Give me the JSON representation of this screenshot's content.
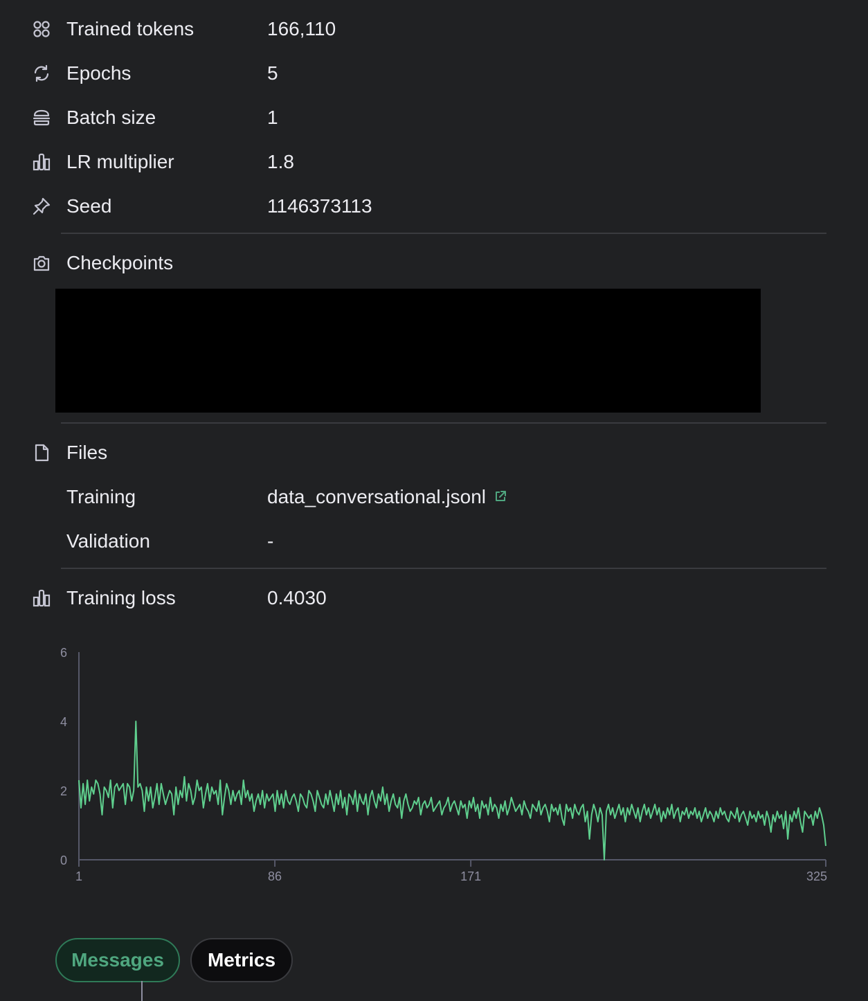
{
  "params": {
    "trained_tokens": {
      "label": "Trained tokens",
      "value": "166,110",
      "icon": "grid-dots-icon"
    },
    "epochs": {
      "label": "Epochs",
      "value": "5",
      "icon": "refresh-icon"
    },
    "batch_size": {
      "label": "Batch size",
      "value": "1",
      "icon": "stack-icon"
    },
    "lr_multiplier": {
      "label": "LR multiplier",
      "value": "1.8",
      "icon": "bar-chart-icon"
    },
    "seed": {
      "label": "Seed",
      "value": "1146373113",
      "icon": "pin-icon"
    }
  },
  "checkpoints": {
    "label": "Checkpoints",
    "icon": "camera-icon"
  },
  "files": {
    "label": "Files",
    "icon": "file-icon",
    "training_label": "Training",
    "training_value": "data_conversational.jsonl",
    "validation_label": "Validation",
    "validation_value": "-"
  },
  "training_loss": {
    "label": "Training loss",
    "value": "0.4030",
    "icon": "bar-chart-icon"
  },
  "colors": {
    "accent": "#4fa67f",
    "loss_line": "#5fcf8e",
    "background": "#202123"
  },
  "chart_data": {
    "type": "line",
    "title": "",
    "xlabel": "",
    "ylabel": "",
    "xlim": [
      1,
      325
    ],
    "ylim": [
      0,
      6
    ],
    "x_ticks": [
      "1",
      "86",
      "171",
      "325"
    ],
    "x_tick_values": [
      1,
      86,
      171,
      325
    ],
    "y_ticks": [
      "0",
      "2",
      "4",
      "6"
    ],
    "y_tick_values": [
      0,
      2,
      4,
      6
    ],
    "grid": false,
    "series": [
      {
        "name": "",
        "values": [
          2.3,
          1.5,
          2.2,
          1.6,
          2.3,
          1.7,
          2.1,
          1.9,
          2.3,
          2.2,
          1.9,
          1.3,
          2.1,
          2.0,
          1.8,
          2.3,
          1.5,
          2.1,
          2.2,
          2.0,
          2.1,
          2.2,
          1.6,
          2.2,
          2.1,
          1.7,
          2.0,
          4.0,
          2.1,
          2.2,
          2.0,
          1.4,
          2.1,
          1.7,
          2.1,
          1.5,
          1.8,
          2.2,
          1.6,
          2.2,
          1.9,
          1.6,
          1.8,
          2.0,
          1.9,
          1.3,
          2.1,
          1.6,
          2.0,
          1.8,
          2.4,
          1.7,
          2.2,
          2.0,
          1.6,
          1.8,
          2.3,
          2.0,
          2.1,
          1.5,
          1.9,
          2.2,
          1.7,
          2.1,
          1.9,
          2.0,
          1.6,
          2.3,
          1.3,
          1.8,
          2.2,
          2.0,
          1.6,
          2.0,
          1.7,
          1.9,
          2.0,
          1.6,
          2.3,
          1.8,
          2.0,
          1.7,
          1.9,
          1.4,
          1.7,
          1.9,
          1.6,
          2.0,
          1.5,
          1.9,
          1.7,
          1.8,
          1.9,
          1.4,
          2.0,
          1.6,
          1.9,
          1.5,
          2.0,
          1.7,
          1.6,
          1.8,
          1.9,
          1.7,
          1.4,
          1.9,
          1.8,
          1.6,
          1.5,
          2.0,
          1.9,
          1.7,
          1.4,
          2.0,
          1.8,
          1.6,
          1.5,
          1.9,
          1.6,
          2.0,
          1.7,
          1.4,
          1.9,
          1.6,
          2.0,
          1.5,
          1.8,
          1.3,
          1.9,
          1.8,
          1.6,
          2.0,
          1.4,
          1.9,
          1.7,
          1.6,
          1.9,
          1.3,
          1.8,
          2.0,
          1.7,
          1.5,
          1.9,
          1.7,
          2.1,
          1.6,
          1.9,
          1.4,
          1.7,
          1.9,
          1.6,
          1.5,
          1.8,
          1.2,
          1.7,
          1.9,
          1.6,
          1.4,
          1.5,
          1.7,
          1.6,
          1.8,
          1.3,
          1.6,
          1.7,
          1.5,
          1.6,
          1.8,
          1.4,
          1.5,
          1.6,
          1.7,
          1.3,
          1.5,
          1.6,
          1.8,
          1.4,
          1.6,
          1.7,
          1.5,
          1.3,
          1.7,
          1.5,
          1.6,
          1.2,
          1.7,
          1.5,
          1.8,
          1.4,
          1.6,
          1.2,
          1.7,
          1.5,
          1.6,
          1.3,
          1.8,
          1.4,
          1.6,
          1.5,
          1.2,
          1.6,
          1.4,
          1.7,
          1.3,
          1.5,
          1.8,
          1.6,
          1.4,
          1.5,
          1.6,
          1.3,
          1.7,
          1.5,
          1.4,
          1.2,
          1.6,
          1.5,
          1.4,
          1.7,
          1.3,
          1.5,
          1.6,
          1.4,
          1.1,
          1.6,
          1.4,
          1.5,
          1.3,
          1.6,
          1.2,
          1.0,
          1.6,
          1.4,
          1.5,
          1.2,
          1.6,
          1.4,
          1.3,
          1.5,
          1.6,
          1.1,
          1.4,
          0.6,
          1.3,
          1.6,
          1.4,
          1.1,
          1.5,
          1.3,
          0.0,
          1.4,
          1.6,
          1.3,
          1.5,
          1.2,
          1.4,
          1.6,
          1.3,
          1.5,
          1.1,
          1.5,
          1.3,
          1.6,
          1.4,
          1.2,
          1.5,
          1.1,
          1.4,
          1.6,
          1.3,
          1.5,
          1.2,
          1.4,
          1.6,
          1.3,
          1.5,
          1.1,
          1.4,
          1.2,
          1.5,
          1.3,
          1.6,
          1.2,
          1.4,
          1.5,
          1.1,
          1.4,
          1.3,
          1.5,
          1.2,
          1.4,
          1.3,
          1.5,
          1.2,
          1.4,
          1.1,
          1.3,
          1.5,
          1.2,
          1.4,
          1.3,
          1.1,
          1.4,
          1.2,
          1.5,
          1.3,
          1.4,
          1.2,
          1.1,
          1.4,
          1.3,
          1.2,
          1.5,
          1.1,
          1.3,
          1.4,
          1.2,
          1.0,
          1.4,
          1.2,
          1.3,
          1.1,
          1.4,
          1.2,
          1.3,
          1.0,
          1.4,
          1.2,
          0.8,
          1.3,
          1.1,
          1.4,
          1.2,
          1.3,
          0.9,
          1.4,
          0.6,
          1.3,
          1.1,
          1.4,
          1.2,
          1.5,
          1.1,
          0.8,
          1.4,
          1.3,
          1.2,
          1.3,
          1.0,
          1.4,
          1.2,
          1.5,
          1.3,
          1.0,
          0.4
        ]
      }
    ]
  },
  "tabs": [
    {
      "label": "Messages",
      "active": true
    },
    {
      "label": "Metrics",
      "active": false
    }
  ]
}
